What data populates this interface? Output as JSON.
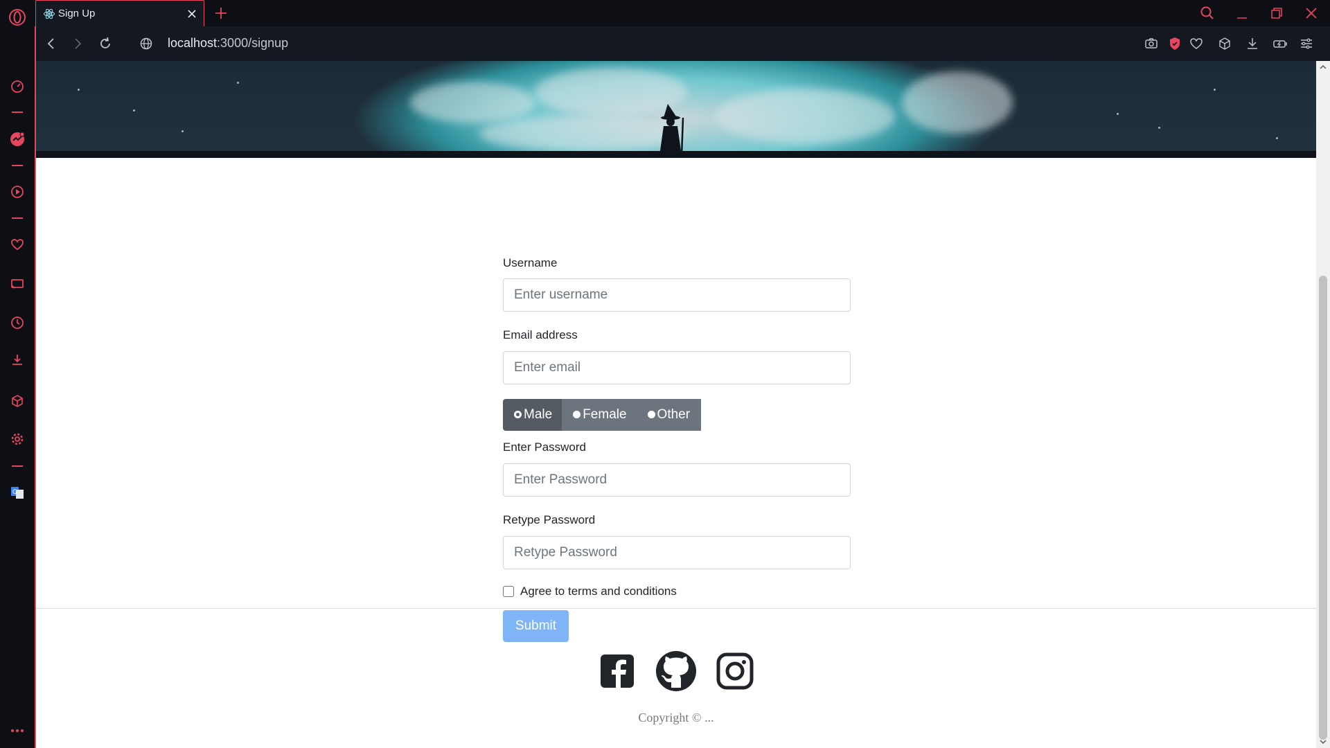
{
  "browser": {
    "tab_title": "Sign Up",
    "url_host": "localhost",
    "url_path": ":3000/signup",
    "accent": "#e8455e"
  },
  "sidebar": {
    "items": [
      "opera-logo",
      "speed-dial",
      "messenger",
      "player",
      "pinboards",
      "my-flow",
      "history",
      "downloads",
      "extensions",
      "settings",
      "translator",
      "more"
    ]
  },
  "form": {
    "username_label": "Username",
    "username_placeholder": "Enter username",
    "email_label": "Email address",
    "email_placeholder": "Enter email",
    "gender_options": [
      "Male",
      "Female",
      "Other"
    ],
    "gender_selected": "Male",
    "password_label": "Enter Password",
    "password_placeholder": "Enter Password",
    "retype_label": "Retype Password",
    "retype_placeholder": "Retype Password",
    "terms_label": "Agree to terms and conditions",
    "submit_label": "Submit",
    "submit_color": "#7fb4f7"
  },
  "footer": {
    "social": [
      "facebook-icon",
      "github-icon",
      "instagram-icon"
    ],
    "copyright": "Copyright © ..."
  }
}
